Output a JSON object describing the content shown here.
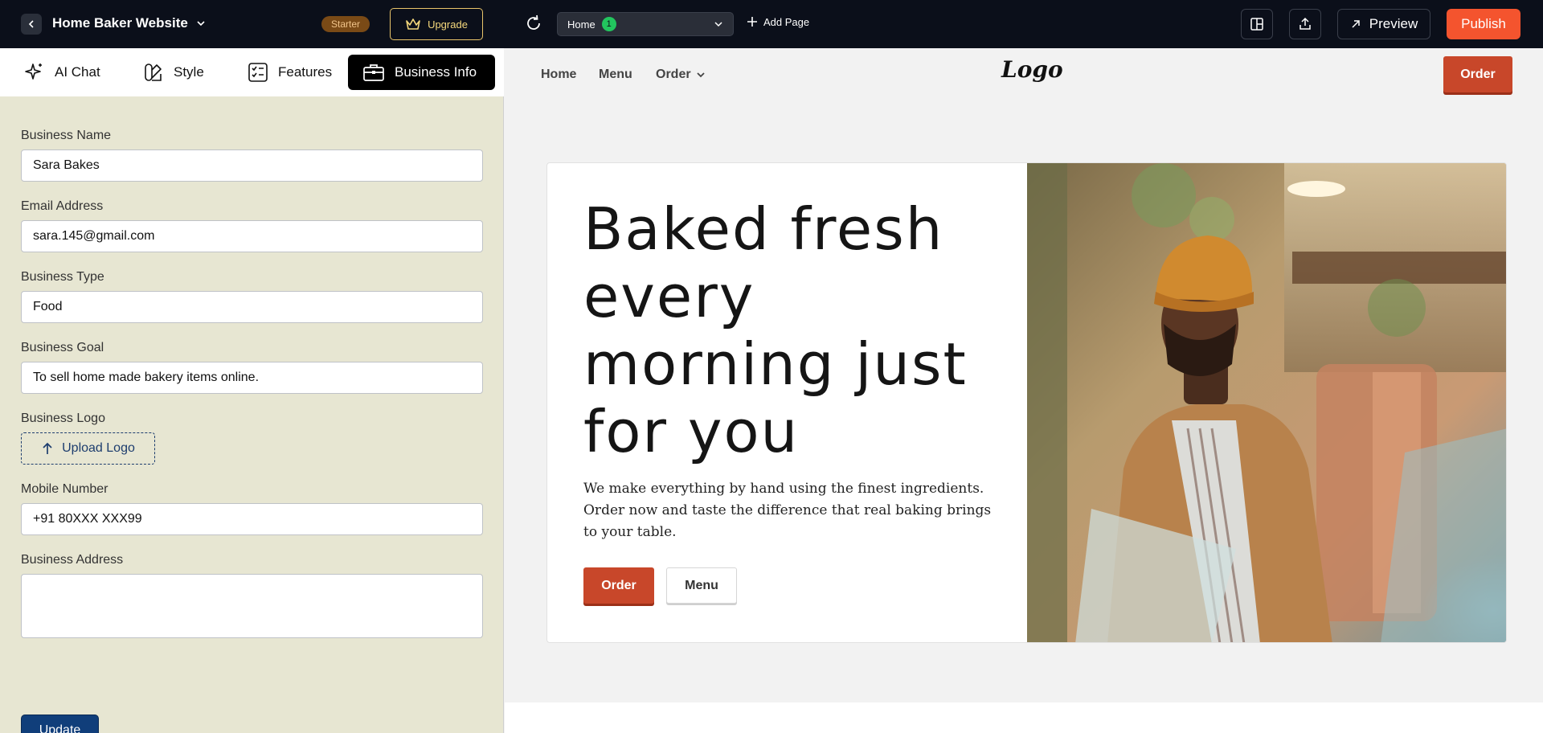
{
  "topbar": {
    "site_title": "Home Baker Website",
    "plan_badge": "Starter",
    "upgrade_label": "Upgrade",
    "page_select": {
      "value": "Home",
      "count": "1"
    },
    "add_page_label": "Add Page",
    "preview_label": "Preview",
    "publish_label": "Publish"
  },
  "tabs": [
    {
      "label": "AI Chat",
      "icon": "sparkle-icon"
    },
    {
      "label": "Style",
      "icon": "palette-icon"
    },
    {
      "label": "Features",
      "icon": "checklist-icon"
    },
    {
      "label": "Business Info",
      "icon": "briefcase-icon",
      "active": true
    }
  ],
  "form": {
    "business_name": {
      "label": "Business Name",
      "value": "Sara Bakes"
    },
    "email": {
      "label": "Email Address",
      "value": "sara.145@gmail.com"
    },
    "business_type": {
      "label": "Business Type",
      "value": "Food"
    },
    "business_goal": {
      "label": "Business Goal",
      "value": "To sell home made bakery items online."
    },
    "business_logo": {
      "label": "Business Logo",
      "upload_label": "Upload Logo"
    },
    "mobile": {
      "label": "Mobile Number",
      "value": "+91 80XXX XXX99"
    },
    "address": {
      "label": "Business Address",
      "value": ""
    },
    "update_label": "Update"
  },
  "preview": {
    "nav": {
      "home": "Home",
      "menu": "Menu",
      "order": "Order"
    },
    "logo": "Logo",
    "nav_order_button": "Order",
    "hero": {
      "title": "Baked fresh every morning just for you",
      "subtitle": "We make everything by hand using the finest ingredients. Order now and taste the difference that real baking brings to your table.",
      "order_button": "Order",
      "menu_button": "Menu"
    }
  },
  "colors": {
    "topbar_bg": "#0b0f1a",
    "publish": "#f4542e",
    "accent_order": "#c8472a",
    "update": "#103e7a",
    "panel_bg": "#e7e6d2"
  }
}
